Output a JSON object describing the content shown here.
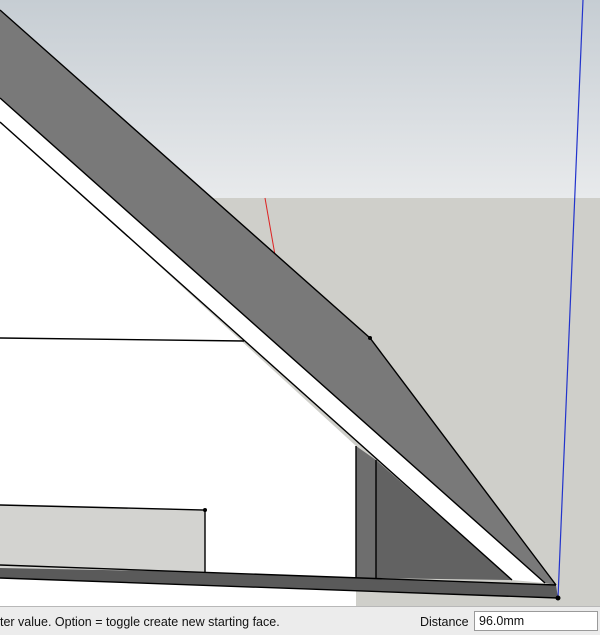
{
  "status_bar": {
    "hint_text": "ter value.  Option = toggle create new starting face.",
    "measurement_label": "Distance",
    "measurement_value": "96.0mm"
  },
  "colors": {
    "sky_top": "#c6cdd3",
    "sky_bottom": "#e8eaec",
    "ground": "#cfcfca",
    "face_white": "#ffffff",
    "face_dark_gray": "#797979",
    "face_medium_gray": "#878787",
    "face_inner_shadow": "#626262",
    "edge_black": "#000000",
    "axis_red": "#dd2222",
    "axis_blue": "#2233cc",
    "status_bg": "#ececec"
  },
  "axes": [
    "red-axis",
    "blue-axis"
  ]
}
